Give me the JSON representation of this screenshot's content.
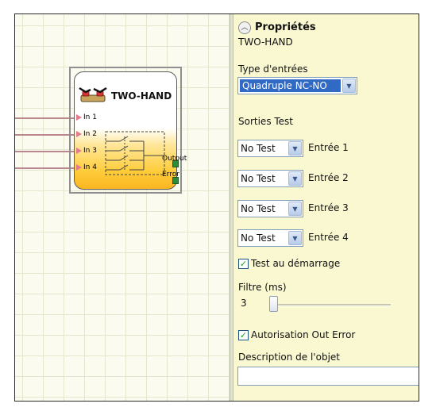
{
  "block": {
    "title": "TWO-HAND",
    "inputs": [
      "In 1",
      "In 2",
      "In 3",
      "In 4"
    ],
    "outputs": [
      "Output",
      "Error"
    ],
    "icon": "two-hand-control-icon"
  },
  "properties": {
    "title": "Propriétés",
    "collapse_icon": "chevron-up-icon",
    "object_name": "TWO-HAND",
    "input_type_label": "Type d'entrées",
    "input_type_value": "Quadruple NC-NO",
    "test_outputs_label": "Sorties Test",
    "test_outputs": [
      {
        "value": "No Test",
        "label": "Entrée 1"
      },
      {
        "value": "No Test",
        "label": "Entrée 2"
      },
      {
        "value": "No Test",
        "label": "Entrée 3"
      },
      {
        "value": "No Test",
        "label": "Entrée 4"
      }
    ],
    "startup_test_label": "Test au démarrage",
    "startup_test_checked": true,
    "filter_label": "Filtre (ms)",
    "filter_value": "3",
    "error_out_label": "Autorisation Out Error",
    "error_out_checked": true,
    "description_label": "Description de l'objet",
    "description_value": ""
  },
  "colors": {
    "panel_bg": "#faf8d1",
    "block_gradient_bottom": "#f9b621",
    "input_arrow": "#e27b8e",
    "output_port": "#2e8b3a",
    "selection": "#316ac5"
  }
}
